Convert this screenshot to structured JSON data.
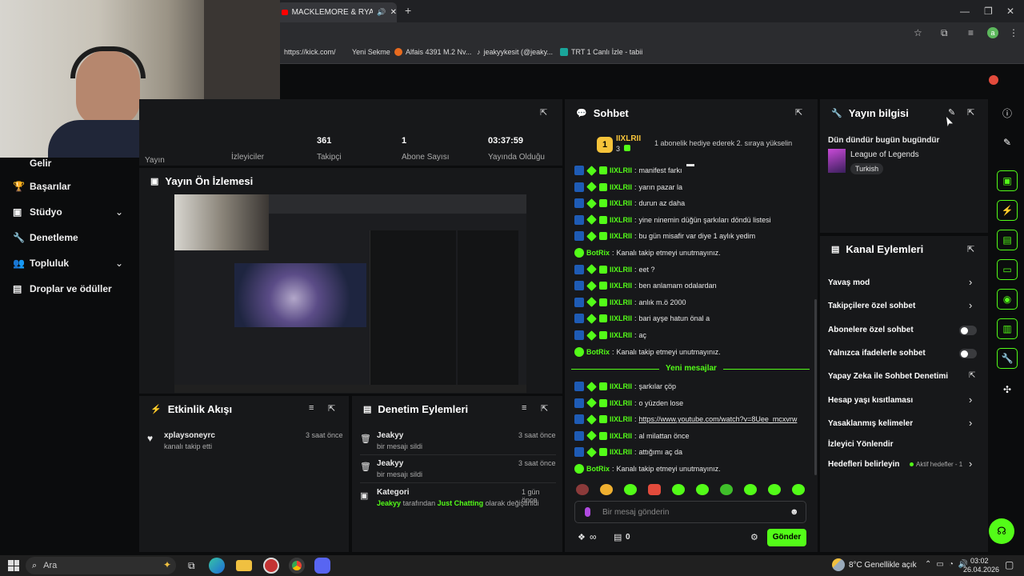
{
  "browser": {
    "tab_title": "MACKLEMORE & RYAN LEW",
    "new_tab": "+",
    "url": "https://kick.com/",
    "bookmarks": [
      "Yeni Sekme",
      "Alfais 4391 M.2 Nv...",
      "jeakyykesit (@jeaky...",
      "TRT 1 Canlı İzle - tabii"
    ],
    "profile_initial": "a"
  },
  "sidebar": {
    "items": [
      {
        "label": "Gelir"
      },
      {
        "label": "Başarılar"
      },
      {
        "label": "Stüdyo",
        "expandable": true
      },
      {
        "label": "Denetleme"
      },
      {
        "label": "Topluluk",
        "expandable": true
      },
      {
        "label": "Droplar ve ödüller"
      }
    ]
  },
  "stats": {
    "partial_labels": [
      "Yayın",
      "İzleyiciler"
    ],
    "items": [
      {
        "value": "361",
        "label": "Takipçi"
      },
      {
        "value": "1",
        "label": "Abone Sayısı"
      },
      {
        "value": "03:37:59",
        "label": "Yayında Olduğu"
      }
    ]
  },
  "preview": {
    "title": "Yayın Ön İzlemesi"
  },
  "activity": {
    "title": "Etkinlik Akışı",
    "items": [
      {
        "user": "xplaysoneyrc",
        "text": "kanalı takip etti",
        "time": "3 saat önce"
      }
    ]
  },
  "moderation": {
    "title": "Denetim Eylemleri",
    "items": [
      {
        "user": "Jeakyy",
        "text": "bir mesajı sildi",
        "time": "3 saat önce"
      },
      {
        "user": "Jeakyy",
        "text": "bir mesajı sildi",
        "time": "3 saat önce"
      },
      {
        "user": "Kategori",
        "by": "Jeakyy",
        "mid": "tarafından",
        "category": "Just Chatting",
        "suffix": "olarak değiştirildi",
        "time": "1 gün önce"
      }
    ]
  },
  "chat": {
    "title": "Sohbet",
    "pinned": {
      "rank": "1",
      "user": "IIXLRII",
      "count": "3",
      "text": "1 abonelik hediye ederek 2. sıraya yükselin"
    },
    "messages": [
      {
        "user": "IIXLRII",
        "text": "manifest farkı"
      },
      {
        "user": "IIXLRII",
        "text": "yarın pazar la"
      },
      {
        "user": "IIXLRII",
        "text": "durun az daha"
      },
      {
        "user": "IIXLRII",
        "text": "yine ninemin düğün şarkıları döndü listesi"
      },
      {
        "user": "IIXLRII",
        "text": "bu gün misafir var diye 1 aylık yedim"
      },
      {
        "user": "BotRix",
        "text": "Kanalı takip etmeyi unutmayınız."
      },
      {
        "user": "IIXLRII",
        "text": "eet ?"
      },
      {
        "user": "IIXLRII",
        "text": "ben anlamam odalardan"
      },
      {
        "user": "IIXLRII",
        "text": "anlık m.ö 2000"
      },
      {
        "user": "IIXLRII",
        "text": "bari ayşe hatun önal a"
      },
      {
        "user": "IIXLRII",
        "text": "aç"
      },
      {
        "user": "BotRix",
        "text": "Kanalı takip etmeyi unutmayınız."
      }
    ],
    "new_messages": "Yeni mesajlar",
    "new": [
      {
        "user": "IIXLRII",
        "text": "şarkılar çöp"
      },
      {
        "user": "IIXLRII",
        "text": "o yüzden lose"
      },
      {
        "user": "IIXLRII",
        "text": "https://www.youtube.com/watch?v=8Uee_mcxvrw"
      },
      {
        "user": "IIXLRII",
        "text": "al milattan önce"
      },
      {
        "user": "IIXLRII",
        "text": "attığımı aç da"
      },
      {
        "user": "BotRix",
        "text": "Kanalı takip etmeyi unutmayınız."
      }
    ],
    "placeholder": "Bir mesaj gönderin",
    "points": "∞",
    "gifts": "0",
    "send": "Gönder"
  },
  "stream_info": {
    "title": "Yayın bilgisi",
    "stream_title": "Dün dündür bugün bugündür",
    "category": "League of Legends",
    "tag": "Turkish"
  },
  "channel_actions": {
    "title": "Kanal Eylemleri",
    "options": [
      {
        "label": "Yavaş mod",
        "control": "arrow"
      },
      {
        "label": "Takipçilere özel sohbet",
        "control": "arrow"
      },
      {
        "label": "Abonelere özel sohbet",
        "control": "toggle"
      },
      {
        "label": "Yalnızca ifadelerle sohbet",
        "control": "toggle"
      },
      {
        "label": "Yapay Zeka ile Sohbet Denetimi",
        "control": "external"
      },
      {
        "label": "Hesap yaşı kısıtlaması",
        "control": "arrow"
      },
      {
        "label": "Yasaklanmış kelimeler",
        "control": "arrow"
      },
      {
        "label": "İzleyici Yönlendir",
        "control": "none"
      },
      {
        "label": "Hedefleri belirleyin",
        "control": "arrow",
        "status": "Aktif hedefler - 1"
      }
    ]
  },
  "taskbar": {
    "search": "Ara",
    "weather": "8°C  Genellikle açık",
    "time": "03:02",
    "date": "26.04.2026"
  },
  "colors": {
    "accent": "#53fc18",
    "panel": "#17181a",
    "bg": "#0b0c0d"
  }
}
